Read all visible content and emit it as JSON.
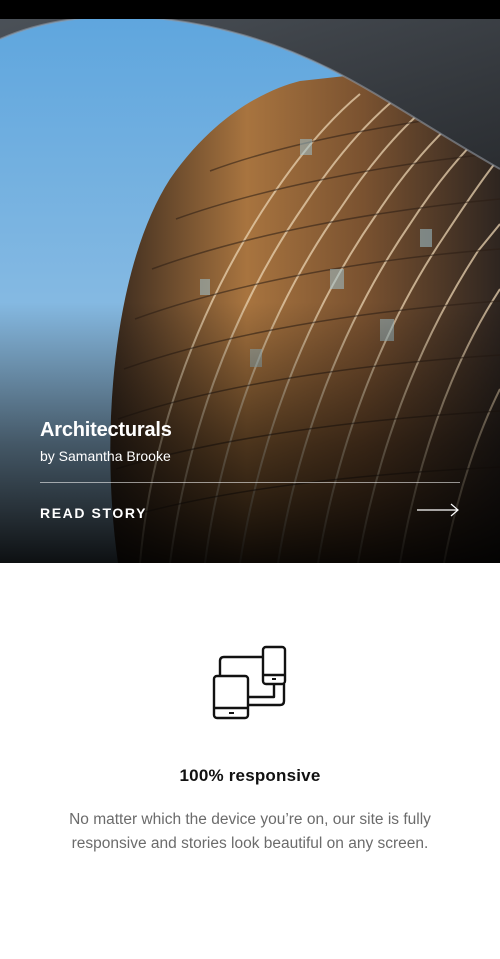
{
  "story": {
    "title": "Architecturals",
    "author": "by Samantha Brooke",
    "cta_label": "READ STORY",
    "cta_icon": "arrow-right-icon",
    "image": "curved-building-photo"
  },
  "feature": {
    "icon": "devices-icon",
    "title": "100% responsive",
    "description": "No matter which the device you’re on, our site is fully responsive and stories look beautiful on any screen."
  },
  "colors": {
    "topbar": "#000000",
    "sky": "#7fb3dc",
    "building": "#8a5a32",
    "text_on_image": "#ffffff",
    "body_text": "#6b6b6b",
    "heading_text": "#111111"
  }
}
